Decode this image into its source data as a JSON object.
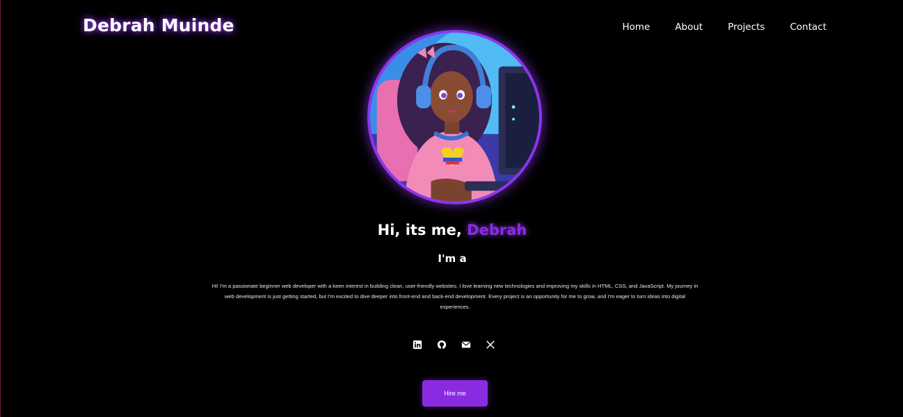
{
  "header": {
    "logo": "Debrah Muinde",
    "nav": [
      "Home",
      "About",
      "Projects",
      "Contact"
    ]
  },
  "hero": {
    "greeting_prefix": "Hi, its me,",
    "greeting_name": "Debrah",
    "role": "I'm a",
    "bio": "Hi! I'm a passionate beginner web developer with a keen interest in building clean, user-friendly websites. I love learning new technologies and improving my skills in HTML, CSS, and JavaScript. My journey in web development is just getting started, but I'm excited to dive deeper into front-end and back-end development. Every project is an opportunity for me to grow, and I'm eager to turn ideas into digital experiences.",
    "socials": [
      "linkedin-icon",
      "github-icon",
      "email-icon",
      "x-icon"
    ],
    "cta_label": "Hire me"
  },
  "colors": {
    "background": "#000000",
    "accent": "#8a2be2",
    "text": "#ffffff"
  }
}
